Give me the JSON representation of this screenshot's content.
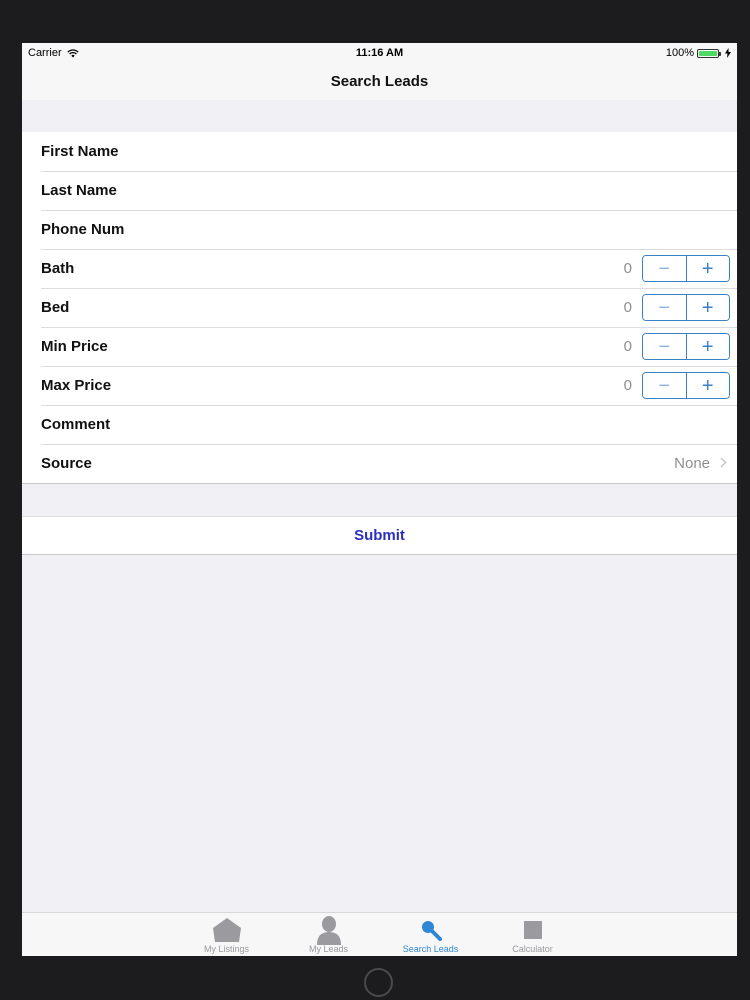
{
  "status_bar": {
    "carrier": "Carrier",
    "time": "11:16 AM",
    "battery": "100%"
  },
  "nav": {
    "title": "Search Leads"
  },
  "form": {
    "first_name_label": "First Name",
    "last_name_label": "Last Name",
    "phone_label": "Phone Num",
    "bath_label": "Bath",
    "bath_value": "0",
    "bed_label": "Bed",
    "bed_value": "0",
    "min_price_label": "Min Price",
    "min_price_value": "0",
    "max_price_label": "Max Price",
    "max_price_value": "0",
    "comment_label": "Comment",
    "source_label": "Source",
    "source_value": "None",
    "stepper_minus": "−",
    "stepper_plus": "+"
  },
  "submit": {
    "label": "Submit"
  },
  "tab_bar": {
    "tabs": [
      {
        "label": "My Listings",
        "icon": "house-icon"
      },
      {
        "label": "My Leads",
        "icon": "person-icon"
      },
      {
        "label": "Search Leads",
        "icon": "search-icon",
        "active": true
      },
      {
        "label": "Calculator",
        "icon": "calculator-icon"
      }
    ]
  },
  "colors": {
    "accent": "#3b82c4",
    "submit": "#2c2fbf",
    "active_tab": "#2f86d4",
    "battery": "#4cd964"
  }
}
